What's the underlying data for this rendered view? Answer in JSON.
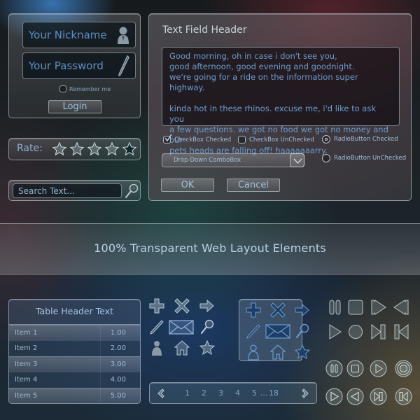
{
  "login": {
    "nickname_placeholder": "Your Nickname",
    "password_placeholder": "Your Password",
    "remember_label": "Remember me",
    "remember_checked": false,
    "login_button": "Login"
  },
  "rating": {
    "label": "Rate:",
    "value": 4,
    "max": 5
  },
  "search": {
    "placeholder": "Search Text..."
  },
  "dialog": {
    "title": "Text Field Header",
    "text_lines": [
      "Good morning, oh in case i don't see you,",
      "good afternoon, good evening and goodnight.",
      "we're going for a ride on the information super highway.",
      "",
      "kinda hot in these rhinos. excuse me, i'd like to ask you",
      "a few questions. we got no food we got no money and our",
      "pets heads are falling off! haaaaaaarry."
    ],
    "checkbox_checked_label": "CheckBox Checked",
    "checkbox_unchecked_label": "CheckBox UnChecked",
    "radio_checked_label": "RadioButton Checked",
    "radio_unchecked_label": "RadioButton UnChecked",
    "combobox_value": "Drop-Down ComboBox",
    "ok_button": "OK",
    "cancel_button": "Cancel"
  },
  "banner": {
    "title": "100% Transparent Web Layout Elements"
  },
  "table": {
    "header": "Table Header Text",
    "rows": [
      {
        "name": "Item 1",
        "value": "1.00"
      },
      {
        "name": "Item 2",
        "value": "2.00"
      },
      {
        "name": "Item 3",
        "value": "3.00"
      },
      {
        "name": "Item 4",
        "value": "4.00"
      },
      {
        "name": "Item 5",
        "value": "5.00"
      }
    ]
  },
  "icons": [
    "plus-icon",
    "close-icon",
    "arrow-right-icon",
    "pen-icon",
    "mail-icon",
    "search-icon",
    "user-icon",
    "home-icon",
    "star-icon"
  ],
  "pager": {
    "pages": [
      "1",
      "2",
      "3",
      "4",
      "5"
    ],
    "ellipsis": "...",
    "last_page": "18"
  },
  "media_controls": {
    "square": [
      "pause-icon",
      "stop-icon",
      "fast-forward-icon",
      "rewind-icon",
      "play-icon",
      "record-icon",
      "skip-next-icon",
      "skip-previous-icon"
    ],
    "round": [
      "pause-icon",
      "stop-icon",
      "play-icon",
      "record-icon",
      "play-icon",
      "previous-icon",
      "skip-next-icon",
      "skip-previous-icon"
    ]
  },
  "colors": {
    "accent_text": "#6c9ccc",
    "glass_border": "#c8d7e1",
    "label_text": "#9fbedb"
  }
}
